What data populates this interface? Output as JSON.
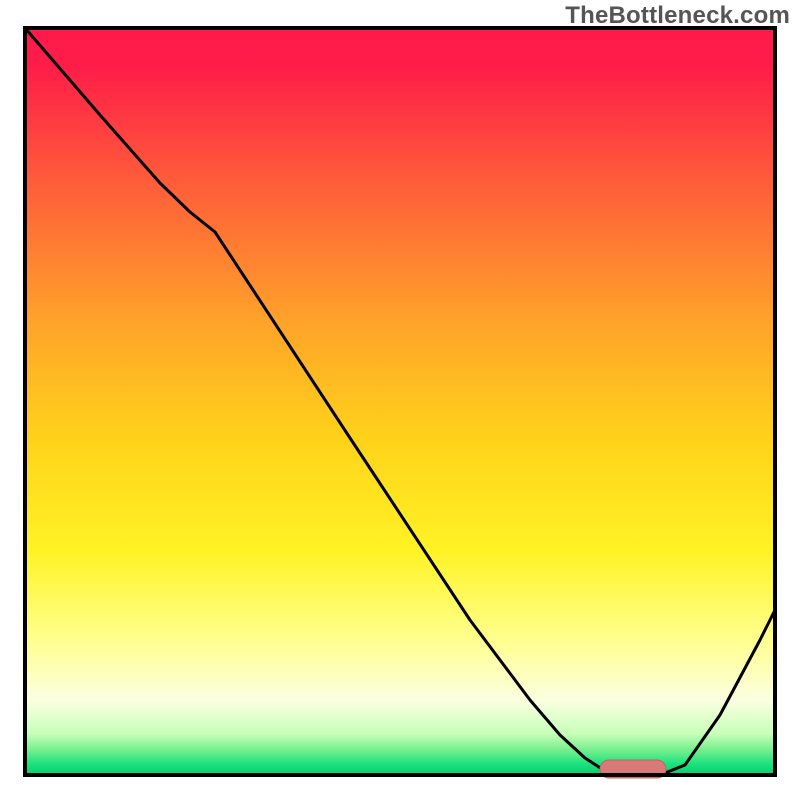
{
  "watermark": "TheBottleneck.com",
  "chart_data": {
    "type": "line",
    "title": "",
    "xlabel": "",
    "ylabel": "",
    "xlim": [
      25,
      775
    ],
    "ylim": [
      775,
      28
    ],
    "axes_visible": false,
    "grid": false,
    "border": {
      "stroke": "#000000",
      "width": 4
    },
    "background_gradient_stops": [
      {
        "offset": 0.0,
        "color": "#ff1a4b"
      },
      {
        "offset": 0.05,
        "color": "#ff1c49"
      },
      {
        "offset": 0.2,
        "color": "#ff5a3a"
      },
      {
        "offset": 0.4,
        "color": "#ffa529"
      },
      {
        "offset": 0.55,
        "color": "#ffd21a"
      },
      {
        "offset": 0.7,
        "color": "#fff325"
      },
      {
        "offset": 0.82,
        "color": "#ffff8f"
      },
      {
        "offset": 0.9,
        "color": "#fbffe0"
      },
      {
        "offset": 0.945,
        "color": "#c7ffb9"
      },
      {
        "offset": 0.965,
        "color": "#7cf08f"
      },
      {
        "offset": 0.985,
        "color": "#1ee27e"
      },
      {
        "offset": 1.0,
        "color": "#07cc6f"
      }
    ],
    "series": [
      {
        "name": "curve",
        "stroke": "#000000",
        "stroke_width": 3,
        "points": [
          {
            "x": 25,
            "y": 28
          },
          {
            "x": 100,
            "y": 115
          },
          {
            "x": 160,
            "y": 183
          },
          {
            "x": 190,
            "y": 212
          },
          {
            "x": 215,
            "y": 232
          },
          {
            "x": 350,
            "y": 438
          },
          {
            "x": 470,
            "y": 620
          },
          {
            "x": 530,
            "y": 700
          },
          {
            "x": 560,
            "y": 735
          },
          {
            "x": 585,
            "y": 758
          },
          {
            "x": 605,
            "y": 771
          },
          {
            "x": 625,
            "y": 775
          },
          {
            "x": 660,
            "y": 775
          },
          {
            "x": 685,
            "y": 765
          },
          {
            "x": 720,
            "y": 715
          },
          {
            "x": 760,
            "y": 640
          },
          {
            "x": 775,
            "y": 610
          }
        ]
      }
    ],
    "marker": {
      "name": "optimum-marker",
      "shape": "rounded-rect",
      "x": 600,
      "y": 760,
      "width": 66,
      "height": 18,
      "rx": 9,
      "fill": "#d87a7a",
      "stroke": "#c46060"
    }
  }
}
